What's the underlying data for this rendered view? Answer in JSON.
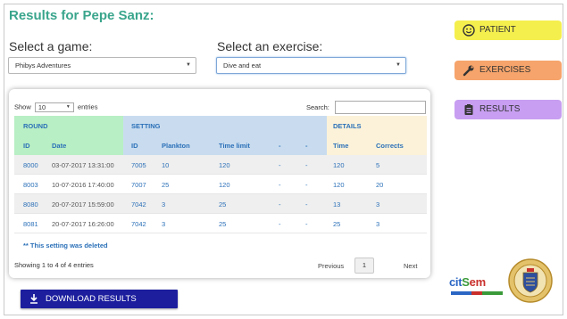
{
  "page_title": "Results for Pepe Sanz:",
  "game": {
    "label": "Select a game:",
    "value": "Phibys Adventures"
  },
  "exercise": {
    "label": "Select an exercise:",
    "value": "Dive and eat"
  },
  "table": {
    "show_prefix": "Show",
    "page_length": "10",
    "show_suffix": "entries",
    "search_label": "Search:",
    "groups": {
      "round": "ROUND",
      "setting": "SETTING",
      "details": "DETAILS"
    },
    "columns": {
      "round_id": "ID",
      "date": "Date",
      "setting_id": "ID",
      "plankton": "Plankton",
      "time_limit": "Time limit",
      "dash1": "-",
      "dash2": "-",
      "time": "Time",
      "corrects": "Corrects"
    },
    "rows": [
      {
        "round_id": "8000",
        "date": "03-07-2017 13:31:00",
        "setting_id": "7005",
        "plankton": "10",
        "time_limit": "120",
        "d1": "-",
        "d2": "-",
        "time": "120",
        "corrects": "5"
      },
      {
        "round_id": "8003",
        "date": "10-07-2016 17:40:00",
        "setting_id": "7007",
        "plankton": "25",
        "time_limit": "120",
        "d1": "-",
        "d2": "-",
        "time": "120",
        "corrects": "20"
      },
      {
        "round_id": "8080",
        "date": "20-07-2017 15:59:00",
        "setting_id": "7042",
        "plankton": "3",
        "time_limit": "25",
        "d1": "-",
        "d2": "-",
        "time": "13",
        "corrects": "3"
      },
      {
        "round_id": "8081",
        "date": "20-07-2017 16:26:00",
        "setting_id": "7042",
        "plankton": "3",
        "time_limit": "25",
        "d1": "-",
        "d2": "-",
        "time": "25",
        "corrects": "3"
      }
    ],
    "note": "** This setting was deleted",
    "info": "Showing 1 to 4 of 4 entries",
    "previous": "Previous",
    "current_page": "1",
    "next": "Next"
  },
  "download_label": "DOWNLOAD RESULTS",
  "nav": {
    "patient": "PATIENT",
    "exercises": "EXERCISES",
    "results": "RESULTS"
  },
  "logo": {
    "cit": "cit",
    "s": "S",
    "em": "em"
  },
  "colors": {
    "title": "#3aa58c",
    "round_header": "#b8efc4",
    "setting_header": "#c9dcef",
    "details_header": "#fbf2d9",
    "link_blue": "#2b70b8",
    "download_button": "#1c1e9e",
    "patient_button": "#f5ef4e",
    "exercises_button": "#f6a46b",
    "results_button": "#c79ef1"
  },
  "icons": {
    "patient": "smiley-face-icon",
    "exercises": "wrench-icon",
    "results": "clipboard-list-icon",
    "download": "download-icon",
    "select_caret": "caret-down-icon",
    "seal": "university-seal-icon"
  }
}
